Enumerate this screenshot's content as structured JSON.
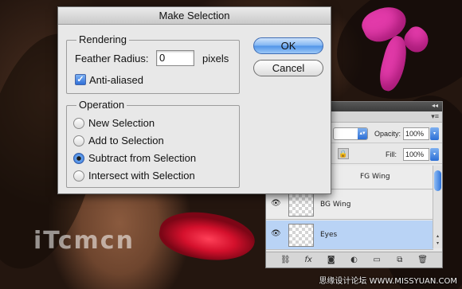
{
  "dialog": {
    "title": "Make Selection",
    "rendering": {
      "label": "Rendering",
      "feather_label": "Feather Radius:",
      "feather_value": "0",
      "feather_unit": "pixels",
      "anti_aliased_label": "Anti-aliased",
      "anti_aliased_checked": true
    },
    "operation": {
      "label": "Operation",
      "options": [
        {
          "label": "New Selection",
          "selected": false
        },
        {
          "label": "Add to Selection",
          "selected": false
        },
        {
          "label": "Subtract from Selection",
          "selected": true
        },
        {
          "label": "Intersect with Selection",
          "selected": false
        }
      ]
    },
    "ok_label": "OK",
    "cancel_label": "Cancel"
  },
  "layers_panel": {
    "opacity_label": "Opacity:",
    "opacity_value": "100%",
    "fill_label": "Fill:",
    "fill_value": "100%",
    "layers": [
      {
        "name": "FG Wing",
        "visible": false,
        "selected": false
      },
      {
        "name": "BG Wing",
        "visible": true,
        "selected": false
      },
      {
        "name": "Eyes",
        "visible": true,
        "selected": true
      }
    ],
    "bottom_icons": [
      "link-icon",
      "fx-icon",
      "mask-icon",
      "adjustment-icon",
      "folder-icon",
      "new-layer-icon",
      "trash-icon"
    ]
  },
  "watermark": "iTcmcn",
  "credit": "思缘设计论坛 WWW.MISSYUAN.COM",
  "colors": {
    "accent": "#2f6fd7",
    "lips": "#e0142e",
    "ribbon": "#e23aa9"
  }
}
